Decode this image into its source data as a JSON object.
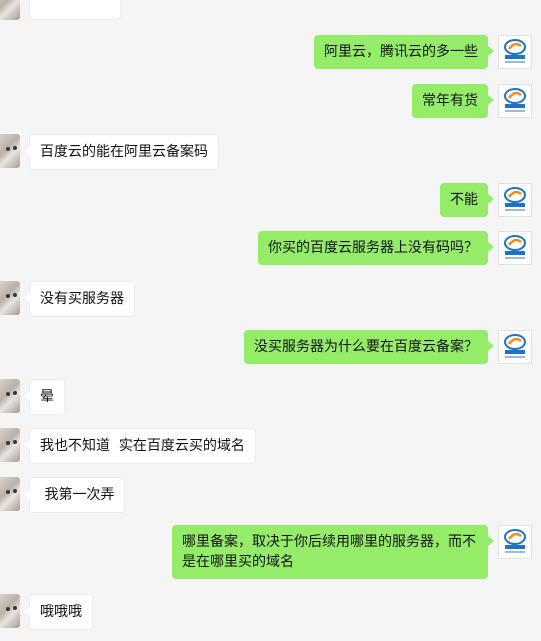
{
  "chat": {
    "messages": [
      {
        "side": "right",
        "text": "阿里云，腾讯云的多一些"
      },
      {
        "side": "right",
        "text": "常年有货"
      },
      {
        "side": "left",
        "text": "百度云的能在阿里云备案码"
      },
      {
        "side": "right",
        "text": "不能"
      },
      {
        "side": "right",
        "text": "你买的百度云服务器上没有码吗？"
      },
      {
        "side": "left",
        "text": "没有买服务器"
      },
      {
        "side": "right",
        "text": "没买服务器为什么要在百度云备案？"
      },
      {
        "side": "left",
        "text": "晕"
      },
      {
        "side": "left",
        "text": "我也不知道  实在百度云买的域名"
      },
      {
        "side": "left",
        "text": " 我第一次弄"
      },
      {
        "side": "right",
        "text": "哪里备案，取决于你后续用哪里的服务器，而不是在哪里买的域名"
      },
      {
        "side": "left",
        "text": "哦哦哦"
      }
    ]
  },
  "colors": {
    "background": "#f5f5f5",
    "bubble_self": "#95ec69",
    "bubble_other": "#ffffff"
  },
  "avatars": {
    "self": "company-logo-icon",
    "other": "cat-avatar"
  }
}
